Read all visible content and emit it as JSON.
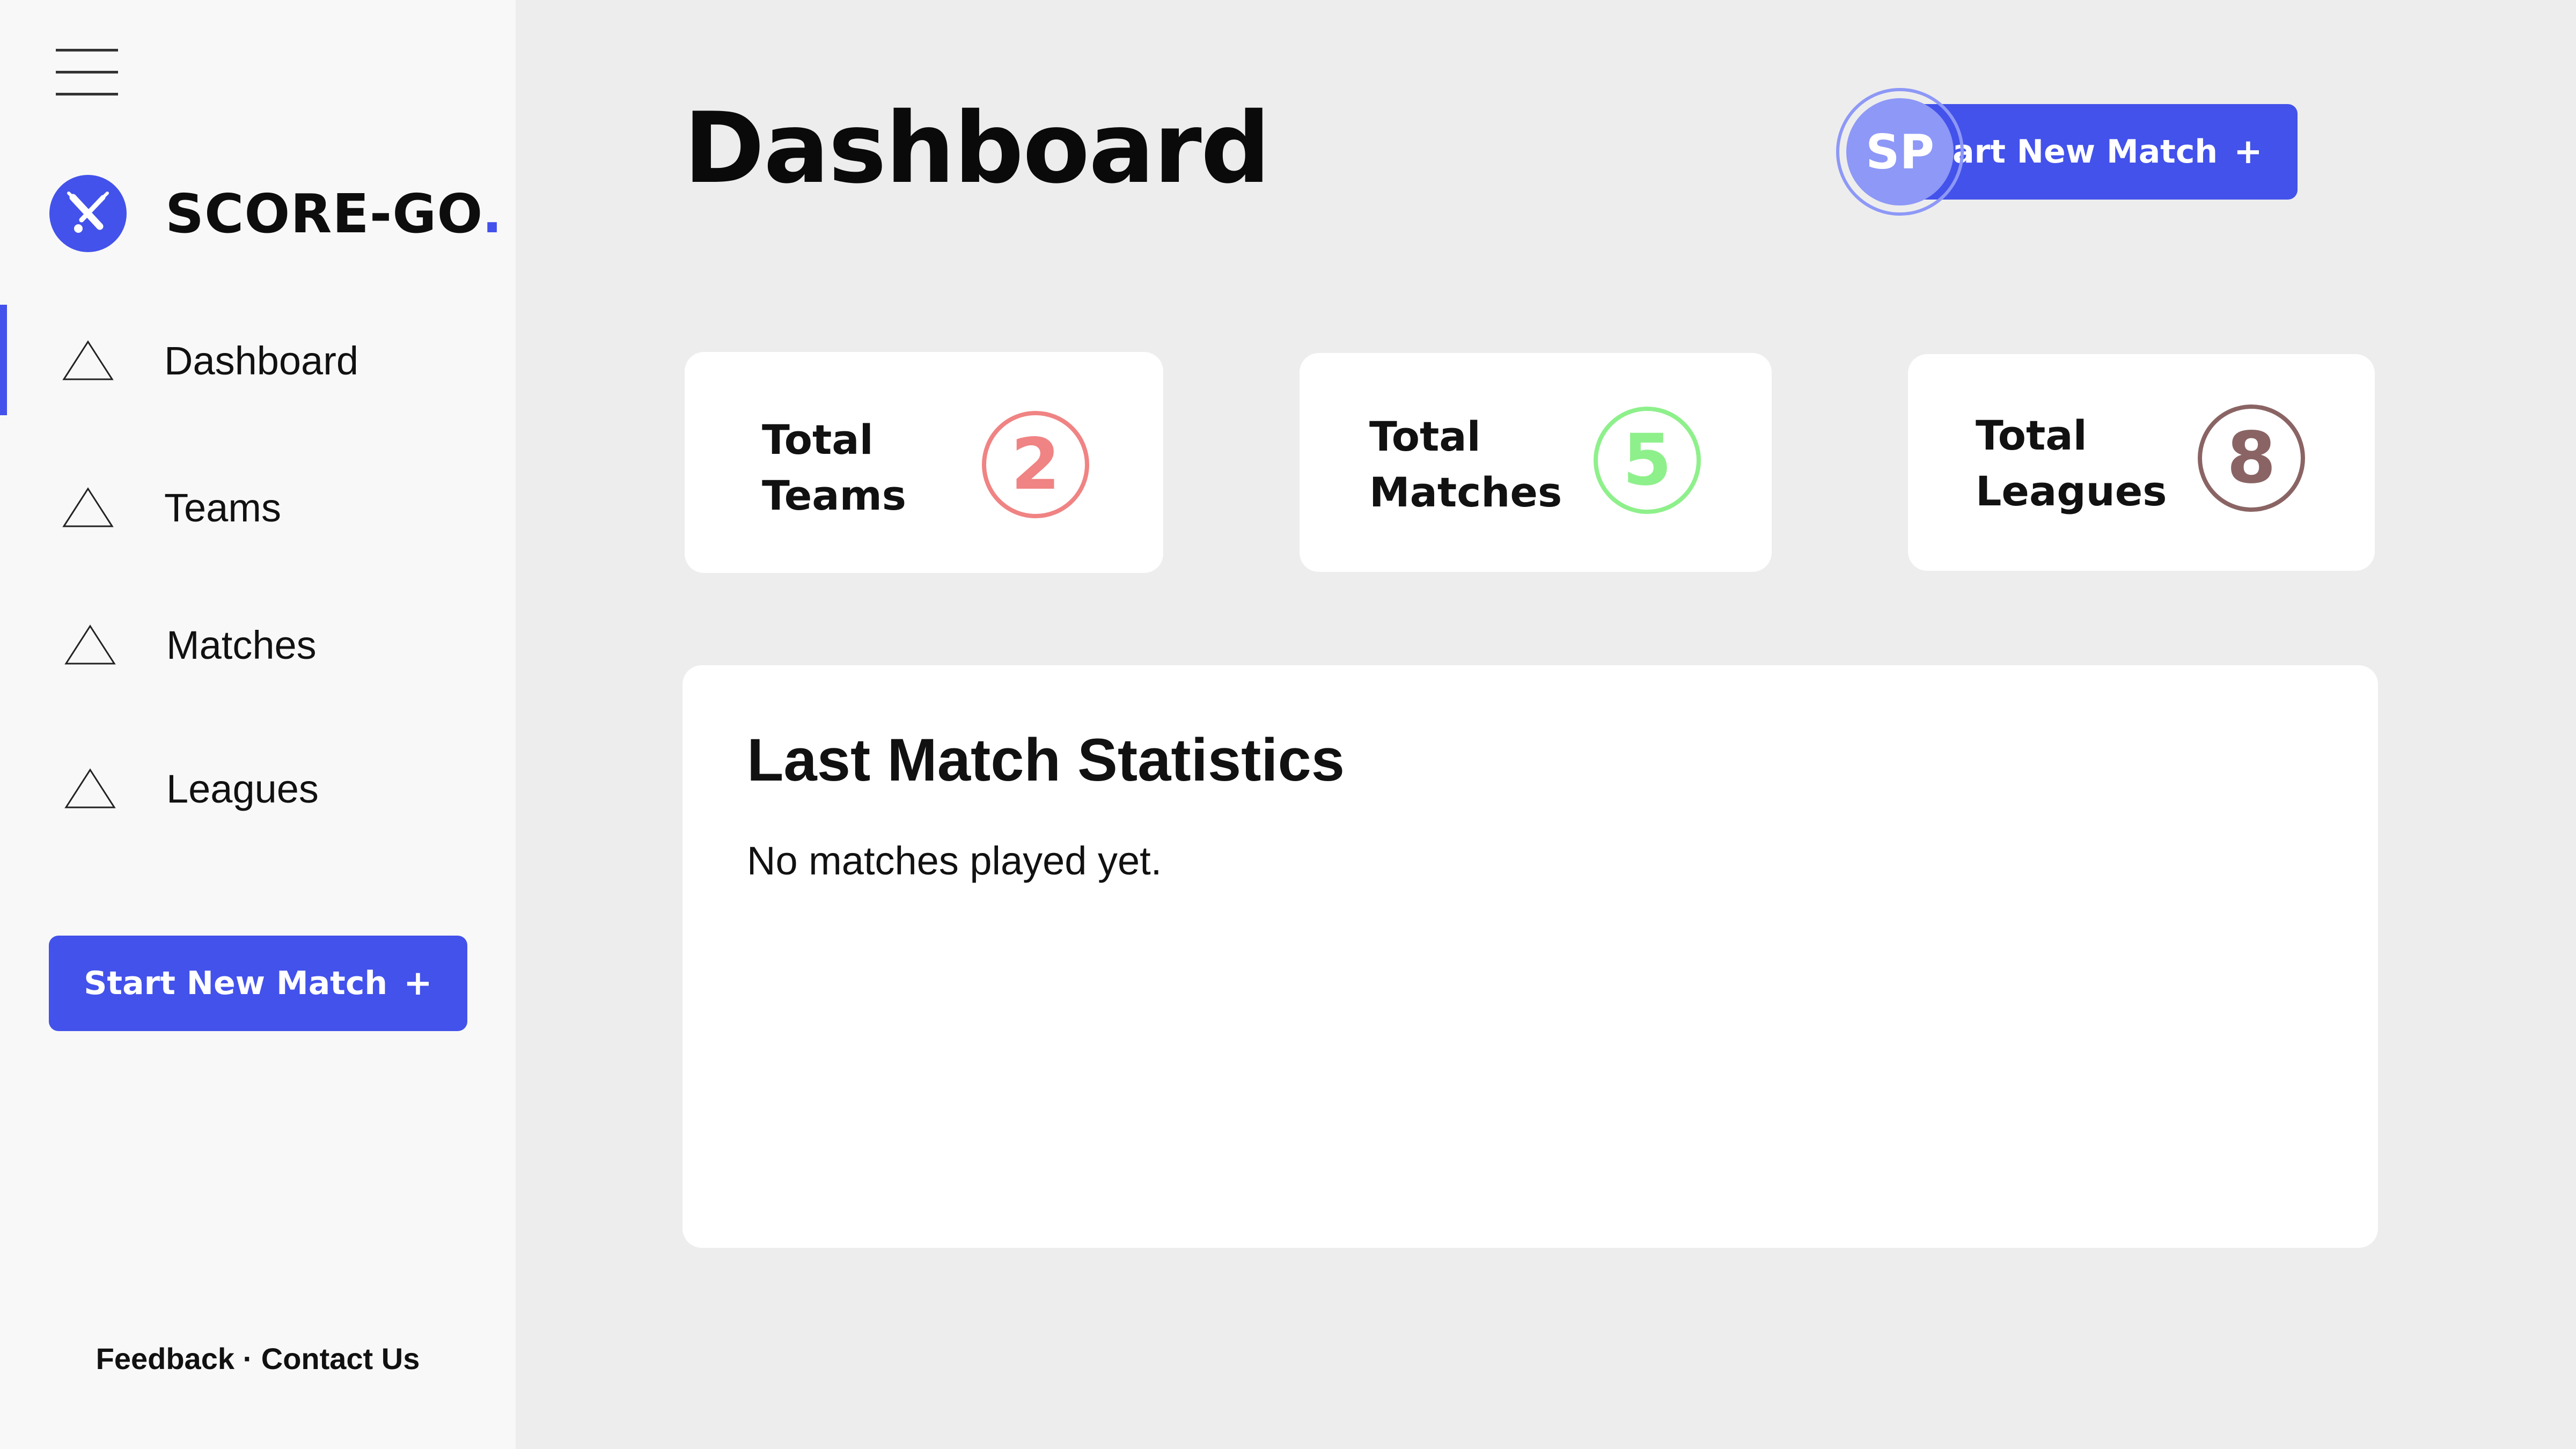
{
  "app": {
    "name": "SCORE-GO",
    "name_suffix": "."
  },
  "sidebar": {
    "items": [
      {
        "label": "Dashboard",
        "icon": "triangle-icon",
        "active": true
      },
      {
        "label": "Teams",
        "icon": "triangle-icon",
        "active": false
      },
      {
        "label": "Matches",
        "icon": "triangle-icon",
        "active": false
      },
      {
        "label": "Leagues",
        "icon": "triangle-icon",
        "active": false
      }
    ],
    "cta_label": "Start New Match",
    "cta_icon": "+",
    "footer": {
      "feedback": "Feedback",
      "separator": "·",
      "contact": "Contact Us"
    }
  },
  "header": {
    "title": "Dashboard",
    "cta_label": "Start New Match",
    "cta_icon": "+",
    "avatar_initials": "SP"
  },
  "stats": [
    {
      "label_line1": "Total",
      "label_line2": "Teams",
      "value": "2",
      "color": "#f08383"
    },
    {
      "label_line1": "Total",
      "label_line2": "Matches",
      "value": "5",
      "color": "#8ef08b"
    },
    {
      "label_line1": "Total",
      "label_line2": "Leagues",
      "value": "8",
      "color": "#8a6464"
    }
  ],
  "last_match": {
    "title": "Last Match Statistics",
    "empty_text": "No matches played yet."
  },
  "colors": {
    "accent": "#4352ea",
    "avatar": "#8d98f7",
    "sidebar_bg": "#f8f8f8",
    "main_bg": "#ededed"
  }
}
